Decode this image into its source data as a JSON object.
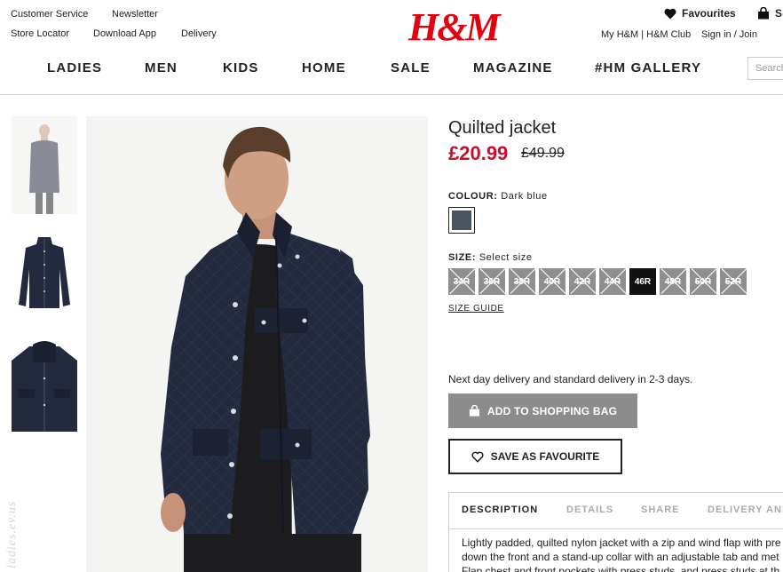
{
  "header": {
    "utility_left": [
      "Customer Service",
      "Newsletter",
      "Store Locator",
      "Download App",
      "Delivery"
    ],
    "logo": "H&M",
    "favourites": "Favourites",
    "bag_partial": "S",
    "account": "My H&M | H&M Club",
    "signin": "Sign in / Join",
    "search_placeholder": "Search"
  },
  "nav": [
    "LADIES",
    "MEN",
    "KIDS",
    "HOME",
    "SALE",
    "MAGAZINE",
    "#HM GALLERY"
  ],
  "watermark": "ladies.ev.us",
  "product": {
    "title": "Quilted jacket",
    "price": "£20.99",
    "old_price": "£49.99",
    "colour_label": "COLOUR:",
    "colour_value": "Dark blue",
    "swatch_color": "#4a5463",
    "size_label": "SIZE:",
    "size_value": "Select size",
    "sizes": [
      {
        "label": "34R",
        "available": false
      },
      {
        "label": "36R",
        "available": false
      },
      {
        "label": "38R",
        "available": false
      },
      {
        "label": "40R",
        "available": false
      },
      {
        "label": "42R",
        "available": false
      },
      {
        "label": "44R",
        "available": false
      },
      {
        "label": "46R",
        "available": true,
        "selected": true
      },
      {
        "label": "48R",
        "available": false
      },
      {
        "label": "50R",
        "available": false
      },
      {
        "label": "52R",
        "available": false
      }
    ],
    "size_guide": "SIZE GUIDE",
    "delivery": "Next day delivery and standard delivery in 2-3 days.",
    "add_to_bag": "ADD TO SHOPPING BAG",
    "save_fav": "SAVE AS FAVOURITE",
    "tabs": [
      "DESCRIPTION",
      "DETAILS",
      "SHARE",
      "DELIVERY AND"
    ],
    "description": [
      "Lightly padded, quilted nylon jacket with a zip and wind flap with pre",
      "down the front and a stand-up collar with an adjustable tab and met",
      "Flap chest and front pockets with press studs, and press studs at th"
    ]
  },
  "colors": {
    "brand_red": "#e50010",
    "price_red": "#c8102e",
    "button_grey": "#8c8c8c",
    "jacket_navy": "#232a3d"
  }
}
